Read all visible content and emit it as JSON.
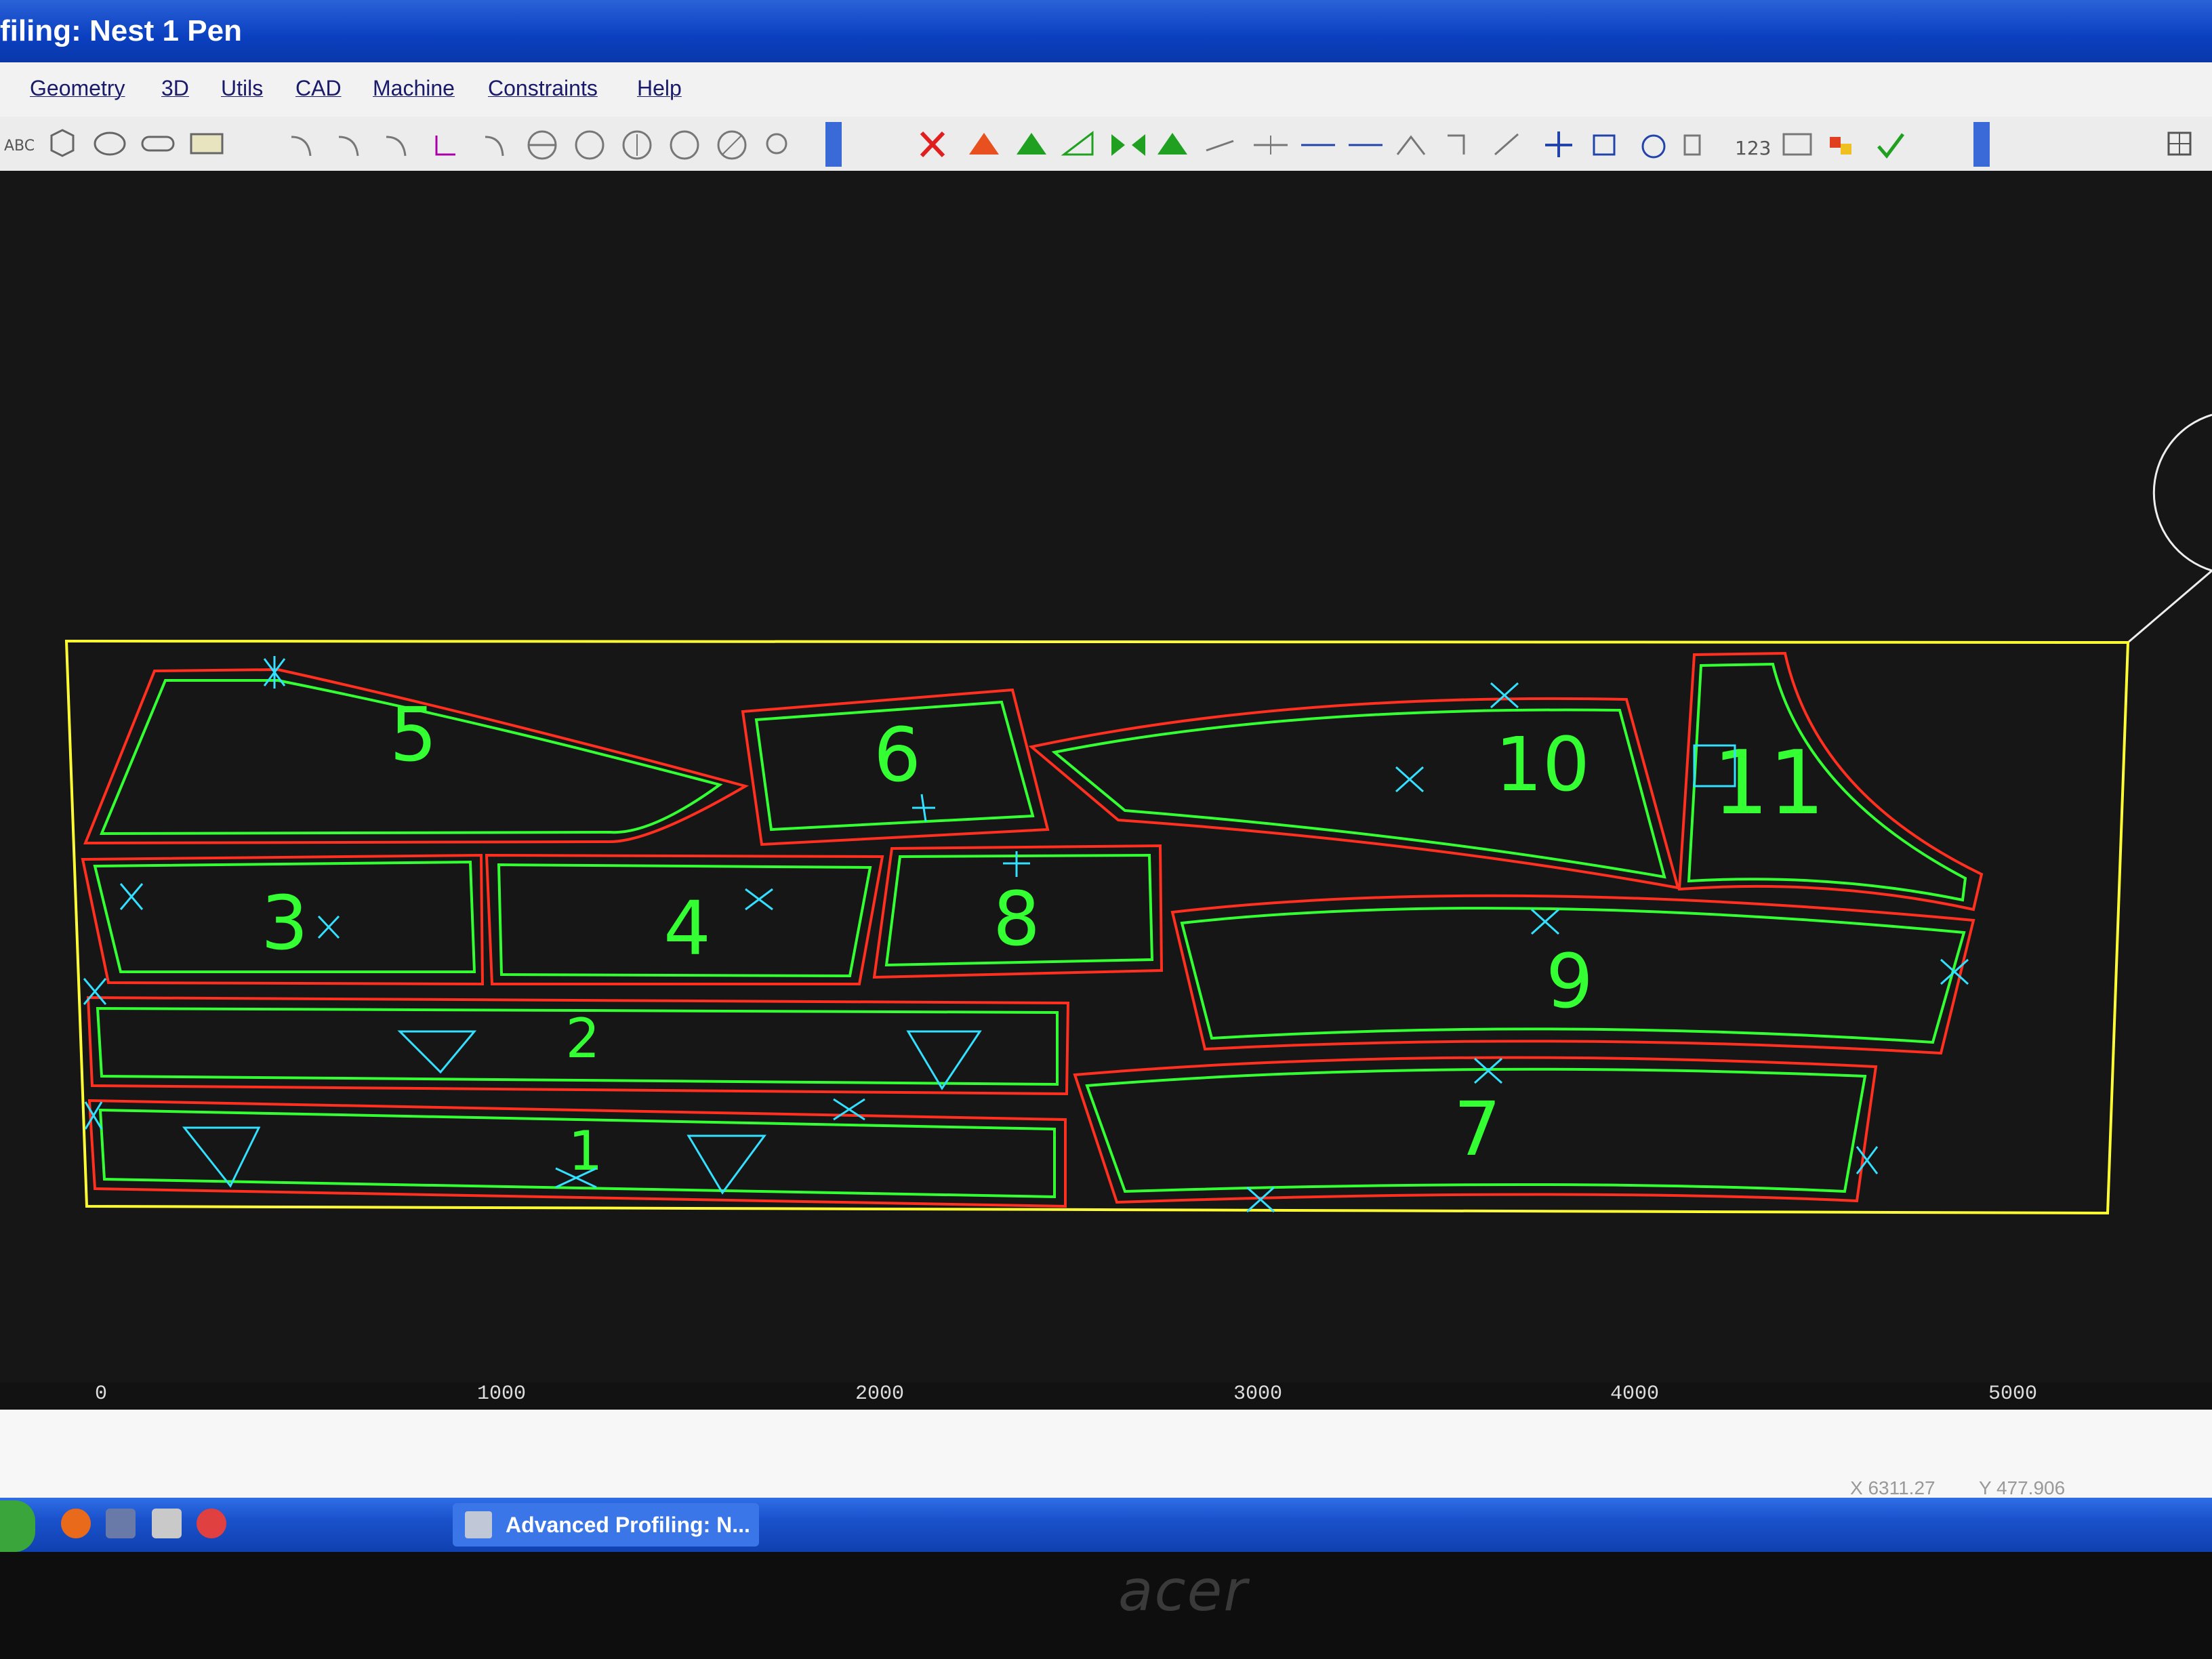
{
  "window": {
    "title": "filing: Nest 1 Pen"
  },
  "menu": {
    "items": [
      "Geometry",
      "3D",
      "Utils",
      "CAD",
      "Machine",
      "Constraints",
      "Help"
    ]
  },
  "toolbar": {
    "icons": [
      "abc-text-icon",
      "polygon-icon",
      "ellipse-icon",
      "rounded-rect-icon",
      "rectangle-icon",
      "arc-icon",
      "arc-icon",
      "arc-icon",
      "fillet-icon",
      "arc-icon",
      "circle-line-icon",
      "circle-icon",
      "circle-cross-icon",
      "circle-icon",
      "circle-slash-icon",
      "zoom-icon",
      "scroll-icon",
      "delete-icon",
      "triangle-icon",
      "triangle-icon",
      "angle-icon",
      "mirror-icon",
      "triangle-icon",
      "line-icon",
      "line-icon",
      "line-icon",
      "line-icon",
      "rotate-icon",
      "corner-icon",
      "trim-icon",
      "cross-icon",
      "expand-icon",
      "rotate-icon",
      "matrix-icon",
      "number-icon",
      "frame-icon",
      "color-icon",
      "check-icon",
      "scroll-icon",
      "grid-icon"
    ],
    "accent_red": "#e02020",
    "accent_green": "#20a020"
  },
  "canvas": {
    "sheet_color": "#ffff33",
    "outer_profile_color": "#ff3020",
    "inner_profile_color": "#33ff33",
    "marker_color": "#33e0ff",
    "parts": [
      {
        "label": "5"
      },
      {
        "label": "6"
      },
      {
        "label": "10"
      },
      {
        "label": "11"
      },
      {
        "label": "3"
      },
      {
        "label": "4"
      },
      {
        "label": "8"
      },
      {
        "label": "9"
      },
      {
        "label": "2"
      },
      {
        "label": "1"
      },
      {
        "label": "7"
      }
    ]
  },
  "ruler": {
    "labels": [
      "0",
      "1000",
      "2000",
      "3000",
      "4000",
      "5000"
    ]
  },
  "status": {
    "x_coord": "X 6311.27",
    "y_coord": "Y 477.906"
  },
  "taskbar": {
    "task_label": "Advanced Profiling: N..."
  },
  "monitor": {
    "brand": "acer"
  }
}
